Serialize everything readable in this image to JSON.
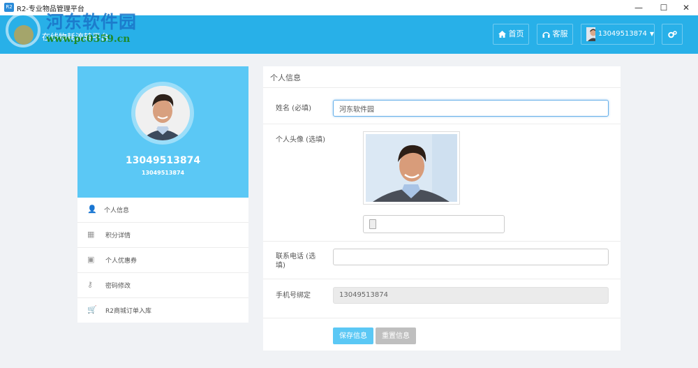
{
  "window": {
    "title": "R2-专业物品管理平台",
    "app_icon_text": "R2",
    "minimize": "—",
    "maximize": "☐",
    "close": "✕"
  },
  "header": {
    "subtitle": "在线物耗流转平台",
    "watermark_cn": "河东软件园",
    "watermark_url": "www.pc0359.cn",
    "home_label": "首页",
    "service_label": "客服",
    "user_label": "13049513874",
    "accent_color": "#28b0e8"
  },
  "profile": {
    "name": "13049513874",
    "sub": "13049513874"
  },
  "menu": [
    {
      "icon": "user-icon",
      "glyph": "👤",
      "label": "个人信息"
    },
    {
      "icon": "list-icon",
      "glyph": "▦",
      "label": "积分详情"
    },
    {
      "icon": "coupon-icon",
      "glyph": "▣",
      "label": "个人优惠券"
    },
    {
      "icon": "key-icon",
      "glyph": "⚷",
      "label": "密码修改"
    },
    {
      "icon": "cart-icon",
      "glyph": "🛒",
      "label": "R2商城订单入库"
    }
  ],
  "form": {
    "title": "个人信息",
    "name_label": "姓名 (必填)",
    "name_value": "河东软件园",
    "avatar_label": "个人头像 (选填)",
    "phone_label_line1": "联系电话 (选",
    "phone_label_line2": "填)",
    "phone_value": "",
    "mobile_label": "手机号绑定",
    "mobile_value": "13049513874",
    "save_label": "保存信息",
    "reset_label": "重置信息"
  }
}
